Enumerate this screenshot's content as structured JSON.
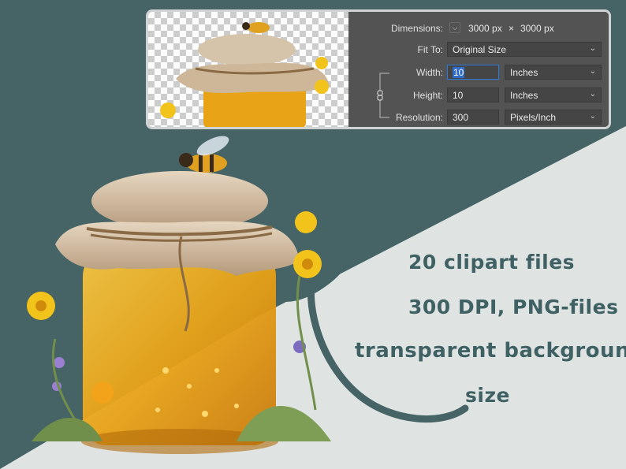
{
  "image_size": {
    "dimensions_label": "Dimensions:",
    "width_px": "3000 px",
    "times": "×",
    "height_px": "3000 px",
    "fit_to_label": "Fit To:",
    "fit_to_value": "Original Size",
    "width_label": "Width:",
    "width_value": "10",
    "width_unit": "Inches",
    "height_label": "Height:",
    "height_value": "10",
    "height_unit": "Inches",
    "resolution_label": "Resolution:",
    "resolution_value": "300",
    "resolution_unit": "Pixels/Inch"
  },
  "promo": {
    "line1": "20  clipart  files",
    "line2": "300 DPI, PNG-files",
    "line3": "transparent background",
    "line4": "size"
  },
  "colors": {
    "teal_dark": "#3f6164",
    "panel_bg": "#535353",
    "page_light": "#dfe4e3",
    "honey": "#e8a317"
  },
  "icons": {
    "link": "chain-link-icon",
    "chevron": "chevron-down-icon"
  }
}
